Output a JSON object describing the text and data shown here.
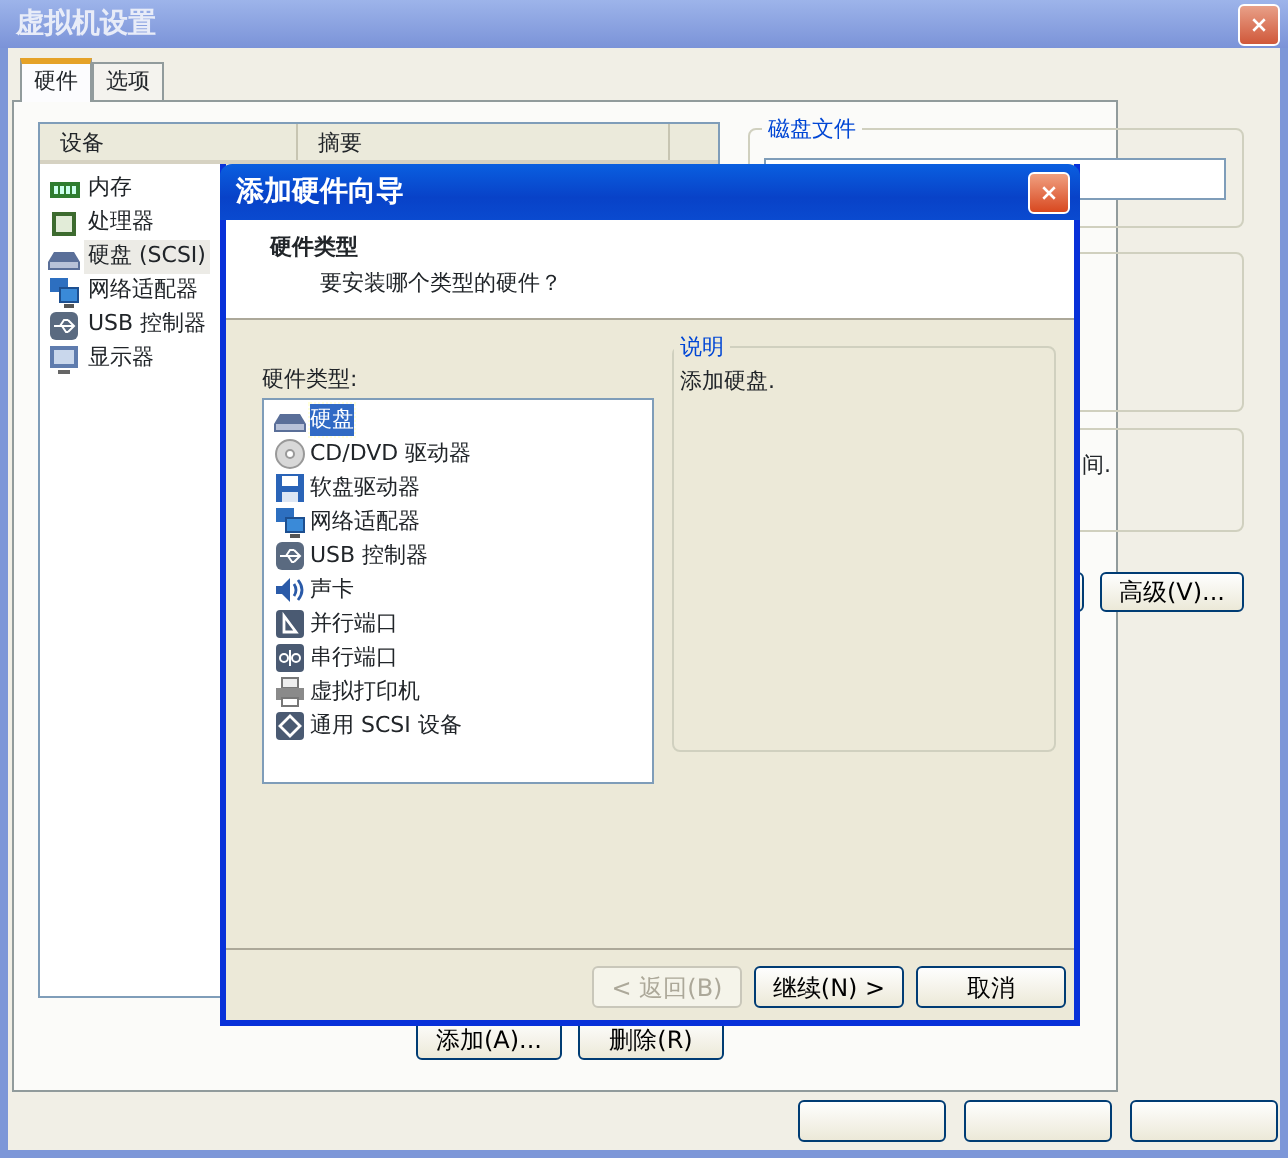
{
  "window": {
    "title": "虚拟机设置"
  },
  "tabs": [
    {
      "label": "硬件",
      "selected": true
    },
    {
      "label": "选项",
      "selected": false
    }
  ],
  "device_table": {
    "columns": [
      "设备",
      "摘要"
    ],
    "rows": [
      {
        "kind": "memory",
        "device": "内存",
        "selected": false
      },
      {
        "kind": "cpu",
        "device": "处理器",
        "selected": false
      },
      {
        "kind": "disk",
        "device": "硬盘 (SCSI)",
        "selected": true
      },
      {
        "kind": "network",
        "device": "网络适配器",
        "selected": false
      },
      {
        "kind": "usb",
        "device": "USB 控制器",
        "selected": false
      },
      {
        "kind": "display",
        "device": "显示器",
        "selected": false
      }
    ]
  },
  "list_buttons": [
    "添加(A)...",
    "删除(R)"
  ],
  "right_panel": {
    "disk_file_group": {
      "title": "磁盘文件"
    },
    "partial_text": "间.",
    "advanced_button": "高级(V)..."
  },
  "wizard": {
    "title": "添加硬件向导",
    "heading": "硬件类型",
    "subheading": "要安装哪个类型的硬件？",
    "list_label": "硬件类型:",
    "hardware_types": [
      {
        "kind": "disk",
        "label": "硬盘",
        "selected": true
      },
      {
        "kind": "cd",
        "label": "CD/DVD 驱动器",
        "selected": false
      },
      {
        "kind": "floppy",
        "label": "软盘驱动器",
        "selected": false
      },
      {
        "kind": "network",
        "label": "网络适配器",
        "selected": false
      },
      {
        "kind": "usb",
        "label": "USB 控制器",
        "selected": false
      },
      {
        "kind": "sound",
        "label": "声卡",
        "selected": false
      },
      {
        "kind": "parallel",
        "label": "并行端口",
        "selected": false
      },
      {
        "kind": "serial",
        "label": "串行端口",
        "selected": false
      },
      {
        "kind": "printer",
        "label": "虚拟打印机",
        "selected": false
      },
      {
        "kind": "scsi",
        "label": "通用 SCSI 设备",
        "selected": false
      }
    ],
    "description_group": {
      "title": "说明",
      "text": "添加硬盘."
    },
    "buttons": [
      {
        "label": "< 返回(B)",
        "disabled": true
      },
      {
        "label": "继续(N) >",
        "disabled": false
      },
      {
        "label": "取消",
        "disabled": false
      }
    ]
  }
}
